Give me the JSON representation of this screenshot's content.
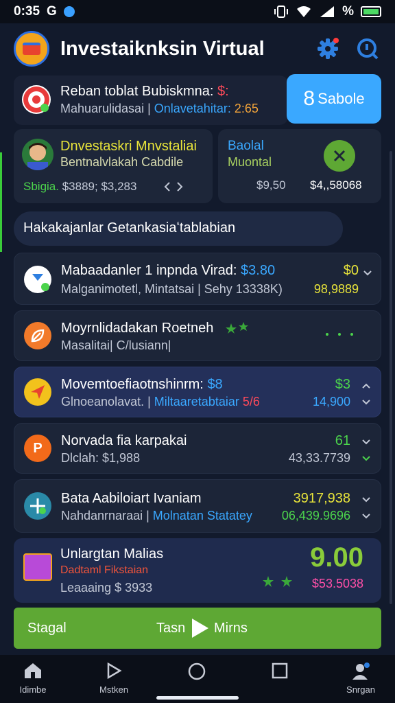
{
  "status": {
    "time": "0:35",
    "left_letter": "G",
    "percent": "%"
  },
  "header": {
    "title": "Investaiknksin Virtual"
  },
  "top_card": {
    "line1": "Reban toblat Bubiskmna:",
    "line1_value": "$:",
    "line2": "Mahuarulidasai |",
    "line2_link": "Onlavetahitar:",
    "line2_value": "2:65",
    "button": "Sabole",
    "button_prefix": "8"
  },
  "portfolio_card": {
    "title": "Dnvestaskri Mnvstaliai",
    "subtitle": "Bentnalvlakah Cabdile",
    "footer_label": "Sbigia.",
    "footer_value": "$3889; $3,283"
  },
  "balance_card": {
    "label1": "Baolal",
    "label2": "Muontal",
    "value_left": "$9,50",
    "value_right": "$4,,58068"
  },
  "section": {
    "title": "Hakakajanlar Getankasiaʻtablabian"
  },
  "rows": [
    {
      "title": "Mabaadanler 1 inpnda Virad:",
      "title_value": "$3.80",
      "subtitle": "Malganimotetl, Mintatsai | Sehy 13338K)",
      "value1": "$0",
      "value2": "98,9889"
    },
    {
      "title": "Moyrnlidadakan Roetneh",
      "subtitle": "Masalitai| C/lusiann|",
      "value1": "",
      "value2": ""
    },
    {
      "title": "Movemtoefiaotnshinrm:",
      "title_value": "$8",
      "subtitle": "Glnoeanolavat. |",
      "subtitle_link": "Miltaaretabtaiar",
      "subtitle_value": "5/6",
      "value1": "$3",
      "value2": "14,900"
    },
    {
      "title": "Norvada fia karpakai",
      "subtitle": "Dlclah: $1,988",
      "value1": "61",
      "value2": "43,33.7739"
    },
    {
      "title": "Bata Aabiloiart Ivaniam",
      "subtitle": "Nahdanrnaraai |",
      "subtitle_link": "Molnatan Statatey",
      "value1": "3917,938",
      "value2": "06,439.9696"
    }
  ],
  "featured": {
    "title": "Unlargtan Malias",
    "subtitle": "Dadtaml Fikstaian",
    "footer": "Leaaaing $ 3933",
    "big_value": "9.00",
    "price": "$53.5038"
  },
  "play_bar": {
    "left": "Stagal",
    "center": "Tasn",
    "right": "Mirns"
  },
  "nav": {
    "item1": "Idimbe",
    "item2": "Mstken",
    "item5": "Snrgan"
  },
  "colors": {
    "accent_blue": "#3aa8ff",
    "accent_green": "#5ea834",
    "background": "#121a2c"
  }
}
